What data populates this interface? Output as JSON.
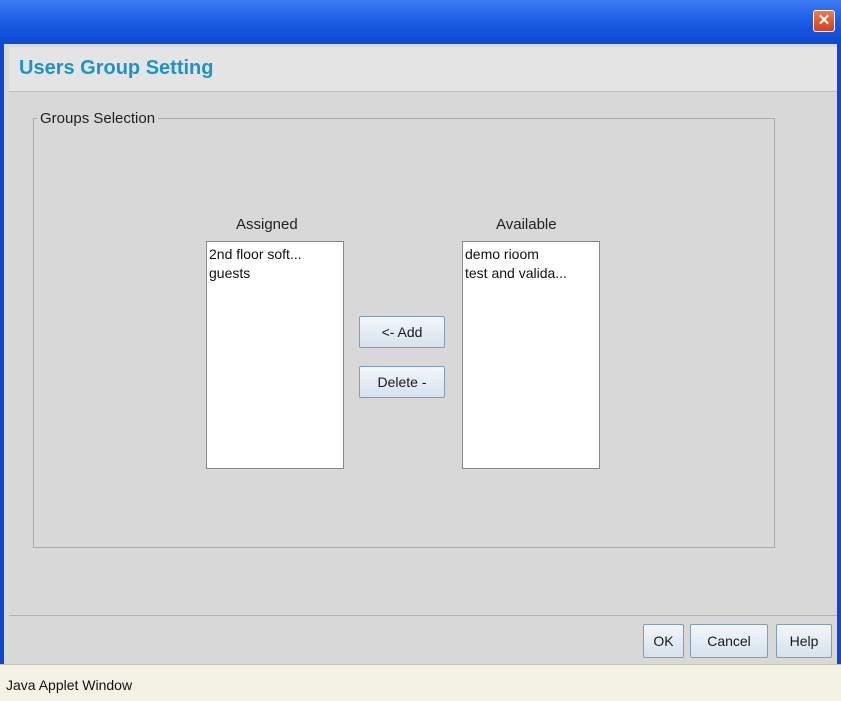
{
  "window": {
    "close_glyph": "✕"
  },
  "dialog": {
    "title": "Users Group Setting"
  },
  "groups_selection": {
    "legend": "Groups Selection",
    "assigned": {
      "label": "Assigned",
      "items": [
        "2nd floor soft...",
        "guests"
      ]
    },
    "available": {
      "label": "Available",
      "items": [
        "demo rioom",
        "test and valida..."
      ]
    },
    "add_label": "<- Add",
    "delete_label": "Delete -"
  },
  "buttons": {
    "ok": "OK",
    "cancel": "Cancel",
    "help": "Help"
  },
  "status_bar": {
    "text": "Java Applet Window"
  }
}
